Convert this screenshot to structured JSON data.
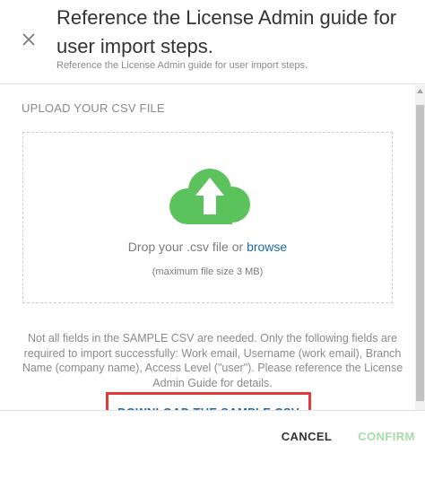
{
  "header": {
    "title": "Reference the License Admin guide for user import steps.",
    "subtitle": "Reference the License Admin guide for user import steps.",
    "close_icon": "close-icon"
  },
  "upload": {
    "section_label": "UPLOAD YOUR CSV FILE",
    "cloud_icon": "cloud-upload-icon",
    "cloud_color": "#5cc35c",
    "drop_text": "Drop your .csv file or",
    "browse_label": "browse",
    "max_size_text": "(maximum file size 3 MB)"
  },
  "info": {
    "text": "Not all fields in the SAMPLE CSV are needed. Only the following fields are required to import successfully: Work email, Username (work email), Branch Name (company name), Access Level (\"user\"). Please reference the License Admin Guide for details.",
    "download_label": "DOWNLOAD THE SAMPLE CSV",
    "highlight_color": "#e03a3a"
  },
  "footer": {
    "cancel_label": "CANCEL",
    "confirm_label": "CONFIRM"
  }
}
